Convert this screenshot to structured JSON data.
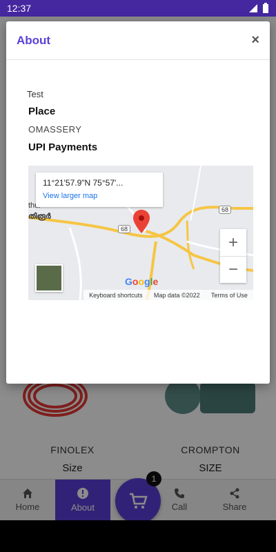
{
  "status_bar": {
    "time": "12:37"
  },
  "dialog": {
    "title": "About",
    "close_label": "×",
    "about_text": "Test",
    "place_label": "Place",
    "place_value": "OMASSERY",
    "upi_label": "UPI Payments"
  },
  "map": {
    "coordinates": "11°21'57.9\"N 75°57'...",
    "view_larger": "View larger map",
    "zoom_in": "+",
    "zoom_out": "−",
    "keyboard_shortcuts": "Keyboard shortcuts",
    "map_data": "Map data ©2022",
    "terms": "Terms of Use",
    "road_shield_1": "68",
    "road_shield_2": "68",
    "place_text_1": "thur",
    "place_text_2": "തിരൂർ"
  },
  "products": [
    {
      "name": "FINOLEX",
      "size_label": "Size"
    },
    {
      "name": "CROMPTON",
      "size_label": "SIZE"
    }
  ],
  "bottom_nav": {
    "items": [
      {
        "label": "Home",
        "icon": "home-icon"
      },
      {
        "label": "About",
        "icon": "info-icon"
      },
      {
        "label": "Call",
        "icon": "phone-icon"
      },
      {
        "label": "Share",
        "icon": "share-icon"
      }
    ],
    "active": "About"
  },
  "cart": {
    "count": "1"
  },
  "colors": {
    "accent": "#5b3fd9",
    "status_bar": "#4527a0"
  }
}
